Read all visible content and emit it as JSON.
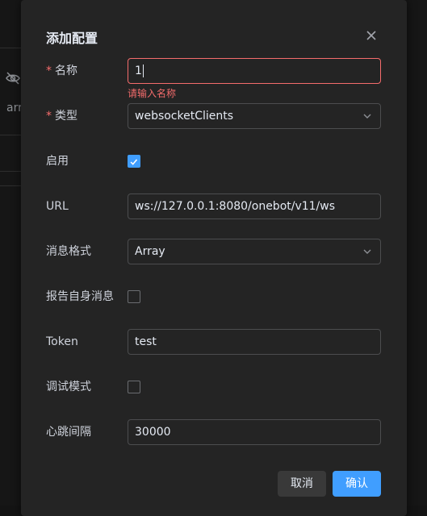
{
  "background": {
    "partial_text": "arr"
  },
  "dialog": {
    "title": "添加配置",
    "close_icon": "close-icon",
    "fields": {
      "name": {
        "label": "名称",
        "value": "1",
        "required": true,
        "error": "请输入名称"
      },
      "type": {
        "label": "类型",
        "value": "websocketClients",
        "required": true
      },
      "enabled": {
        "label": "启用",
        "checked": true
      },
      "url": {
        "label": "URL",
        "value": "ws://127.0.0.1:8080/onebot/v11/ws"
      },
      "message_format": {
        "label": "消息格式",
        "value": "Array"
      },
      "report_self": {
        "label": "报告自身消息",
        "checked": false
      },
      "token": {
        "label": "Token",
        "value": "test"
      },
      "debug": {
        "label": "调试模式",
        "checked": false
      },
      "heartbeat": {
        "label": "心跳间隔",
        "value": "30000"
      }
    },
    "buttons": {
      "cancel": "取消",
      "confirm": "确认"
    }
  },
  "colors": {
    "accent": "#409eff",
    "error": "#f56c6c",
    "dialog_bg": "#242424"
  }
}
